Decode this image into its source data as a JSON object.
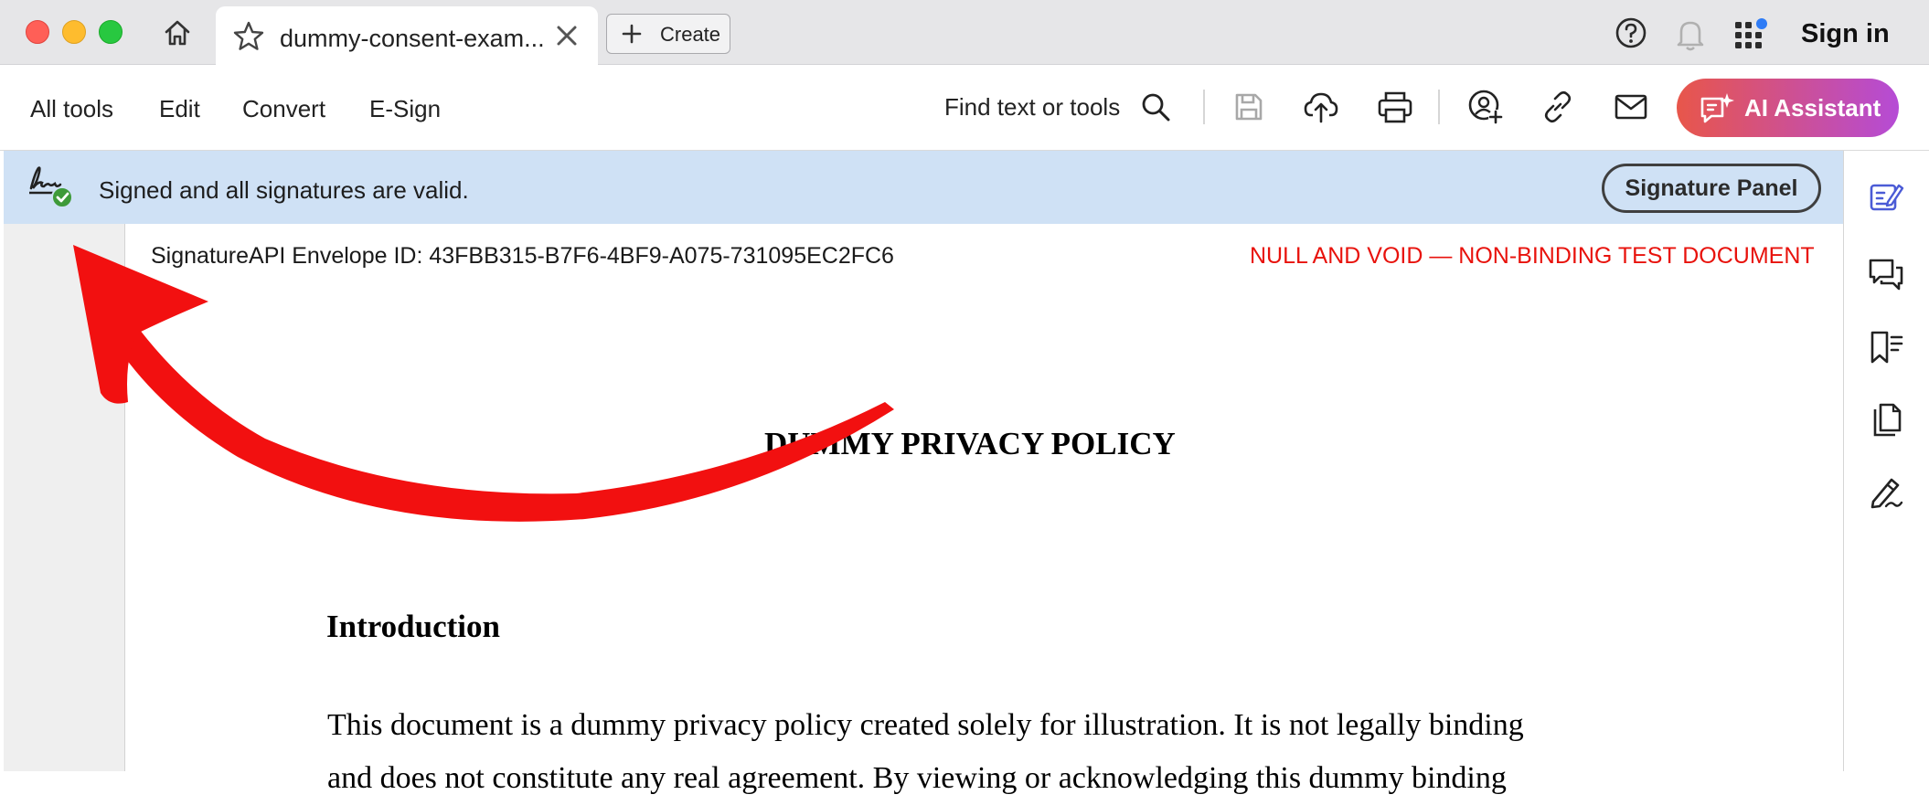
{
  "titlebar": {
    "tab_title": "dummy-consent-exam...",
    "create_label": "Create",
    "sign_in_label": "Sign in"
  },
  "toolbar": {
    "menu": [
      "All tools",
      "Edit",
      "Convert",
      "E-Sign"
    ],
    "find_label": "Find text or tools",
    "ai_label": "AI Assistant"
  },
  "banner": {
    "status_text": "Signed and all signatures are valid.",
    "panel_button_label": "Signature Panel"
  },
  "document": {
    "envelope_id": "SignatureAPI Envelope ID: 43FBB315-B7F6-4BF9-A075-731095EC2FC6",
    "void_note": "NULL AND VOID — NON-BINDING TEST DOCUMENT",
    "title": "DUMMY PRIVACY POLICY",
    "intro_heading": "Introduction",
    "body_lines": [
      "This document is a dummy privacy policy created solely for illustration. It is not legally binding",
      "and does not constitute any real agreement. By viewing or acknowledging this dummy binding"
    ]
  },
  "colors": {
    "banner_bg": "#cfe1f5",
    "void_red": "#e8120c",
    "ai_gradient_start": "#e8564a",
    "ai_gradient_end": "#b54bd6",
    "annotation_arrow": "#f21010"
  },
  "icons": {
    "traffic_lights": [
      "close-dot",
      "minimize-dot",
      "zoom-dot"
    ],
    "rail": [
      "edit-panel-icon",
      "comment-icon",
      "bookmark-icon",
      "pages-icon",
      "fill-sign-icon"
    ]
  }
}
